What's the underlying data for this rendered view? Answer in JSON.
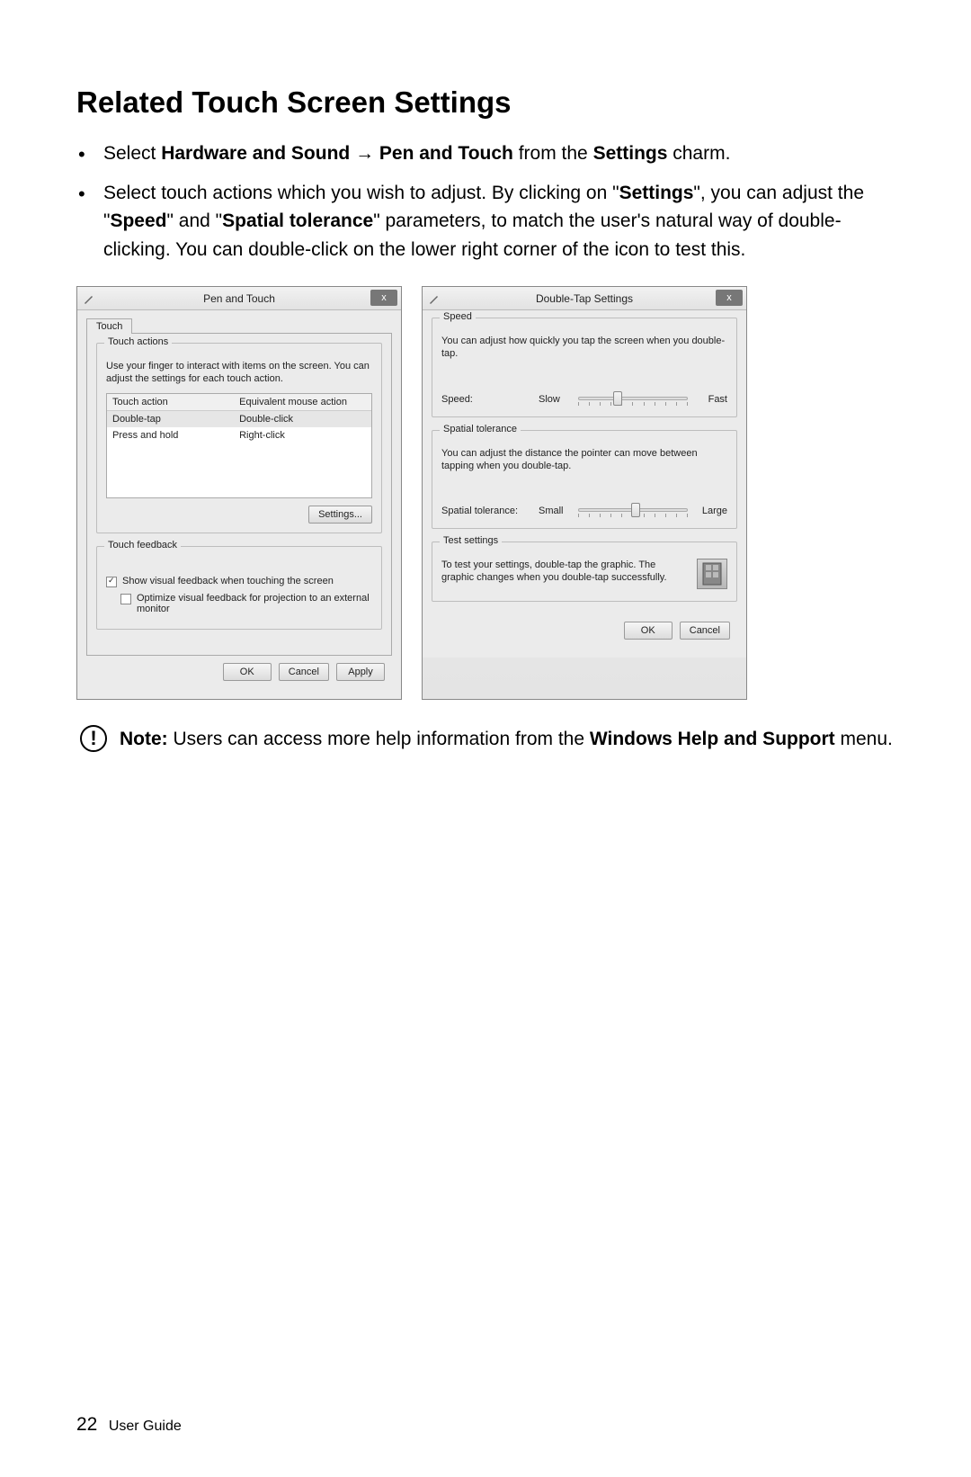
{
  "heading": "Related Touch Screen Settings",
  "bullet1": {
    "pre": "Select ",
    "b1": "Hardware and Sound",
    "arrow": " → ",
    "b2": "Pen and Touch",
    "mid": " from the ",
    "b3": "Settings",
    "post": " charm."
  },
  "bullet2": {
    "pre": "Select touch actions which you wish to adjust. By clicking on \"",
    "b1": "Settings",
    "mid1": "\", you can adjust the \"",
    "b2": "Speed",
    "mid2": "\" and \"",
    "b3": "Spatial tolerance",
    "post": "\" parameters, to match the user's natural way of double-clicking. You can double-click on the lower right corner of the icon to test this."
  },
  "dialog1": {
    "title": "Pen and Touch",
    "close": "x",
    "tab": "Touch",
    "group_actions": "Touch actions",
    "actions_desc": "Use your finger to interact with items on the screen. You can adjust the settings for each touch action.",
    "table": {
      "h1": "Touch action",
      "h2": "Equivalent mouse action",
      "r1c1": "Double-tap",
      "r1c2": "Double-click",
      "r2c1": "Press and hold",
      "r2c2": "Right-click"
    },
    "settings_btn": "Settings...",
    "group_feedback": "Touch feedback",
    "chk1": "Show visual feedback when touching the screen",
    "chk2": "Optimize visual feedback for projection to an external monitor",
    "ok": "OK",
    "cancel": "Cancel",
    "apply": "Apply"
  },
  "dialog2": {
    "title": "Double-Tap Settings",
    "close": "x",
    "group_speed": "Speed",
    "speed_desc": "You can adjust how quickly you tap the screen when you double-tap.",
    "speed_label": "Speed:",
    "slow": "Slow",
    "fast": "Fast",
    "group_spatial": "Spatial tolerance",
    "spatial_desc": "You can adjust the distance the pointer can move between tapping when you double-tap.",
    "spatial_label": "Spatial tolerance:",
    "small": "Small",
    "large": "Large",
    "group_test": "Test settings",
    "test_desc": "To test your settings, double-tap the graphic. The graphic changes when you double-tap successfully.",
    "ok": "OK",
    "cancel": "Cancel"
  },
  "note": {
    "icon": "!",
    "label": "Note:",
    "pre": " Users can access more help information from the ",
    "b1": "Windows Help and Support",
    "post": " menu."
  },
  "footer": {
    "page": "22",
    "label": "User Guide"
  }
}
